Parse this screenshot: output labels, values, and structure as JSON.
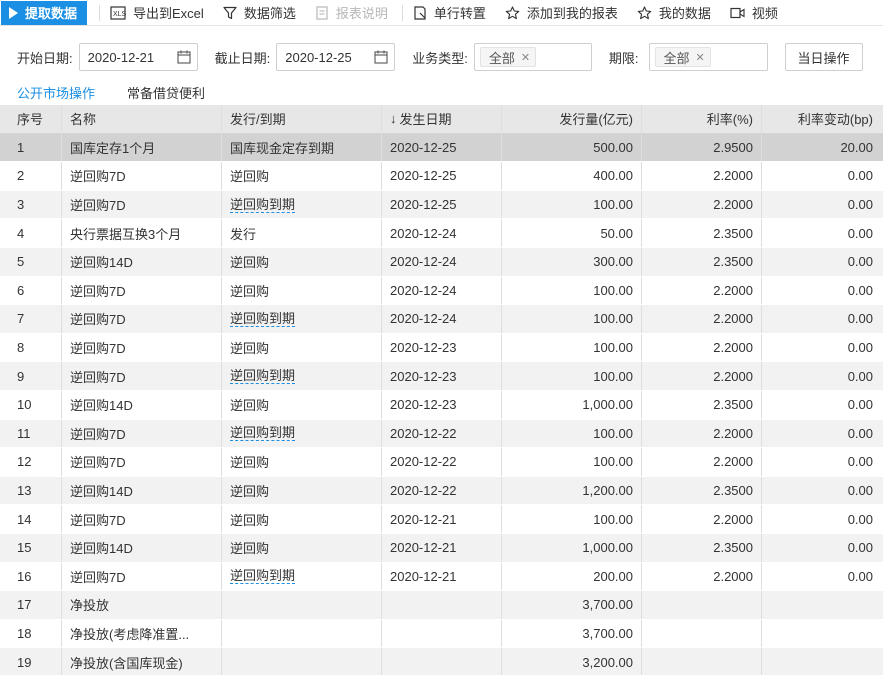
{
  "toolbar": {
    "fetch_label": "提取数据",
    "export_label": "导出到Excel",
    "filter_label": "数据筛选",
    "report_note_label": "报表说明",
    "transpose_label": "单行转置",
    "add_report_label": "添加到我的报表",
    "my_data_label": "我的数据",
    "video_label": "视频"
  },
  "filters": {
    "start_label": "开始日期:",
    "start_value": "2020-12-21",
    "end_label": "截止日期:",
    "end_value": "2020-12-25",
    "biz_label": "业务类型:",
    "biz_value": "全部",
    "term_label": "期限:",
    "term_value": "全部",
    "today_label": "当日操作"
  },
  "subtabs": [
    "公开市场操作",
    "常备借贷便利"
  ],
  "table": {
    "headers": [
      "序号",
      "名称",
      "发行/到期",
      "发生日期",
      "发行量(亿元)",
      "利率(%)",
      "利率变动(bp)"
    ],
    "sort_arrow": "↓",
    "rows": [
      {
        "no": "1",
        "name": "国库定存1个月",
        "type": "国库现金定存到期",
        "link": false,
        "date": "2020-12-25",
        "amount": "500.00",
        "rate": "2.9500",
        "chg": "20.00"
      },
      {
        "no": "2",
        "name": "逆回购7D",
        "type": "逆回购",
        "link": false,
        "date": "2020-12-25",
        "amount": "400.00",
        "rate": "2.2000",
        "chg": "0.00"
      },
      {
        "no": "3",
        "name": "逆回购7D",
        "type": "逆回购到期",
        "link": true,
        "date": "2020-12-25",
        "amount": "100.00",
        "rate": "2.2000",
        "chg": "0.00"
      },
      {
        "no": "4",
        "name": "央行票据互换3个月",
        "type": "发行",
        "link": false,
        "date": "2020-12-24",
        "amount": "50.00",
        "rate": "2.3500",
        "chg": "0.00"
      },
      {
        "no": "5",
        "name": "逆回购14D",
        "type": "逆回购",
        "link": false,
        "date": "2020-12-24",
        "amount": "300.00",
        "rate": "2.3500",
        "chg": "0.00"
      },
      {
        "no": "6",
        "name": "逆回购7D",
        "type": "逆回购",
        "link": false,
        "date": "2020-12-24",
        "amount": "100.00",
        "rate": "2.2000",
        "chg": "0.00"
      },
      {
        "no": "7",
        "name": "逆回购7D",
        "type": "逆回购到期",
        "link": true,
        "date": "2020-12-24",
        "amount": "100.00",
        "rate": "2.2000",
        "chg": "0.00"
      },
      {
        "no": "8",
        "name": "逆回购7D",
        "type": "逆回购",
        "link": false,
        "date": "2020-12-23",
        "amount": "100.00",
        "rate": "2.2000",
        "chg": "0.00"
      },
      {
        "no": "9",
        "name": "逆回购7D",
        "type": "逆回购到期",
        "link": true,
        "date": "2020-12-23",
        "amount": "100.00",
        "rate": "2.2000",
        "chg": "0.00"
      },
      {
        "no": "10",
        "name": "逆回购14D",
        "type": "逆回购",
        "link": false,
        "date": "2020-12-23",
        "amount": "1,000.00",
        "rate": "2.3500",
        "chg": "0.00"
      },
      {
        "no": "11",
        "name": "逆回购7D",
        "type": "逆回购到期",
        "link": true,
        "date": "2020-12-22",
        "amount": "100.00",
        "rate": "2.2000",
        "chg": "0.00"
      },
      {
        "no": "12",
        "name": "逆回购7D",
        "type": "逆回购",
        "link": false,
        "date": "2020-12-22",
        "amount": "100.00",
        "rate": "2.2000",
        "chg": "0.00"
      },
      {
        "no": "13",
        "name": "逆回购14D",
        "type": "逆回购",
        "link": false,
        "date": "2020-12-22",
        "amount": "1,200.00",
        "rate": "2.3500",
        "chg": "0.00"
      },
      {
        "no": "14",
        "name": "逆回购7D",
        "type": "逆回购",
        "link": false,
        "date": "2020-12-21",
        "amount": "100.00",
        "rate": "2.2000",
        "chg": "0.00"
      },
      {
        "no": "15",
        "name": "逆回购14D",
        "type": "逆回购",
        "link": false,
        "date": "2020-12-21",
        "amount": "1,000.00",
        "rate": "2.3500",
        "chg": "0.00"
      },
      {
        "no": "16",
        "name": "逆回购7D",
        "type": "逆回购到期",
        "link": true,
        "date": "2020-12-21",
        "amount": "200.00",
        "rate": "2.2000",
        "chg": "0.00"
      },
      {
        "no": "17",
        "name": "净投放",
        "type": "",
        "link": false,
        "date": "",
        "amount": "3,700.00",
        "rate": "",
        "chg": ""
      },
      {
        "no": "18",
        "name": "净投放(考虑降准置...",
        "type": "",
        "link": false,
        "date": "",
        "amount": "3,700.00",
        "rate": "",
        "chg": ""
      },
      {
        "no": "19",
        "name": "净投放(含国库现金)",
        "type": "",
        "link": false,
        "date": "",
        "amount": "3,200.00",
        "rate": "",
        "chg": ""
      }
    ]
  },
  "colors": {
    "accent": "#1a8fe3",
    "header_bg": "#e7e7e7",
    "selected_row": "#d2d2d2",
    "stripe": "#f2f2f2"
  }
}
